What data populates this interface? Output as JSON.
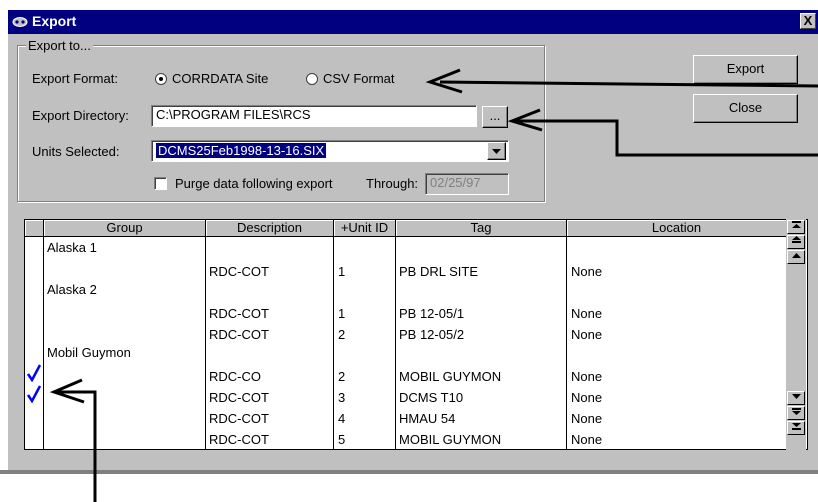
{
  "window": {
    "title": "Export",
    "close_label": "X"
  },
  "export_group": {
    "title": "Export to...",
    "format_label": "Export Format:",
    "format_options": [
      "CORRDATA Site",
      "CSV Format"
    ],
    "selected_format": "CORRDATA Site",
    "directory_label": "Export Directory:",
    "directory_value": "C:\\PROGRAM FILES\\RCS",
    "browse_label": "...",
    "units_label": "Units Selected:",
    "units_value": "DCMS25Feb1998-13-16.SIX",
    "purge_label": "Purge data following export",
    "purge_checked": false,
    "through_label": "Through:",
    "through_value": "02/25/97"
  },
  "buttons": {
    "export": "Export",
    "close": "Close"
  },
  "grid": {
    "columns": [
      "Group",
      "Description",
      "+Unit ID",
      "Tag",
      "Location"
    ],
    "rows": [
      {
        "group": "Alaska 1",
        "description": "",
        "unit_id": "",
        "tag": "",
        "location": ""
      },
      {
        "group": "",
        "description": "RDC-COT",
        "unit_id": "1",
        "tag": "PB DRL SITE",
        "location": "None"
      },
      {
        "group": "Alaska 2",
        "description": "",
        "unit_id": "",
        "tag": "",
        "location": ""
      },
      {
        "group": "",
        "description": "RDC-COT",
        "unit_id": "1",
        "tag": "PB 12-05/1",
        "location": "None"
      },
      {
        "group": "",
        "description": "RDC-COT",
        "unit_id": "2",
        "tag": "PB 12-05/2",
        "location": "None"
      },
      {
        "group": "Mobil Guymon",
        "description": "",
        "unit_id": "",
        "tag": "",
        "location": ""
      },
      {
        "group": "",
        "description": "RDC-CO",
        "unit_id": "2",
        "tag": "MOBIL GUYMON",
        "location": "None",
        "checked": true
      },
      {
        "group": "",
        "description": "RDC-COT",
        "unit_id": "3",
        "tag": "DCMS T10",
        "location": "None",
        "checked": true
      },
      {
        "group": "",
        "description": "RDC-COT",
        "unit_id": "4",
        "tag": "HMAU 54",
        "location": "None"
      },
      {
        "group": "",
        "description": "RDC-COT",
        "unit_id": "5",
        "tag": "MOBIL GUYMON",
        "location": "None"
      }
    ]
  },
  "colors": {
    "titlebar": "#000080",
    "face": "#c0c0c0",
    "check": "#0000ff"
  }
}
